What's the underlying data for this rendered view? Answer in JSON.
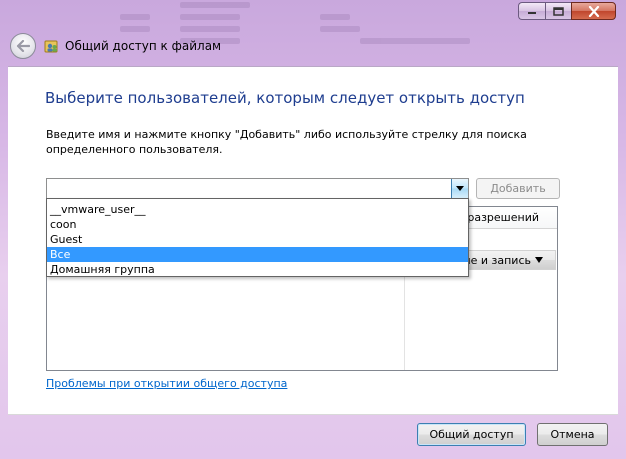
{
  "window": {
    "title": "Общий доступ к файлам"
  },
  "content": {
    "heading": "Выберите пользователей, которым следует открыть доступ",
    "instruction": "Введите имя и нажмите кнопку \"Добавить\" либо используйте стрелку для поиска определенного пользователя.",
    "combo_value": "",
    "add_label": "Добавить",
    "column_perm_label": "Уровень разрешений",
    "row_perm_value": "Чтение и запись",
    "dropdown_items": [
      "__vmware_user__",
      "coon",
      "Guest",
      "Все",
      "Домашняя группа"
    ],
    "selected_index": 3,
    "help_link": "Проблемы при открытии общего доступа"
  },
  "footer": {
    "share_label": "Общий доступ",
    "cancel_label": "Отмена"
  },
  "colors": {
    "heading": "#1e3d8f",
    "link": "#0066cc",
    "selection": "#3399ff"
  }
}
